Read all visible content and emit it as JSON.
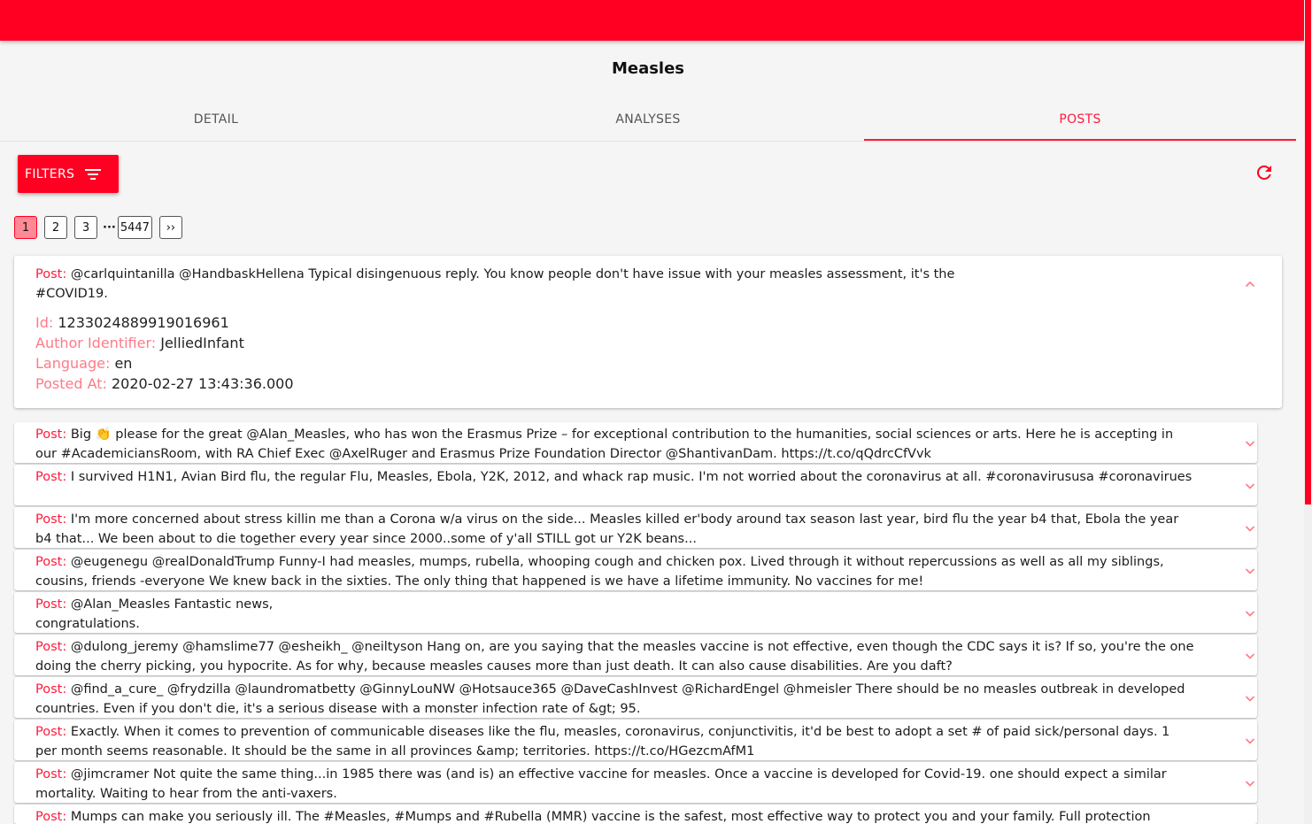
{
  "page": {
    "title": "Measles"
  },
  "tabs": [
    {
      "label": "DETAIL"
    },
    {
      "label": "ANALYSES"
    },
    {
      "label": "POSTS"
    }
  ],
  "toolbar": {
    "filters_label": "FILTERS"
  },
  "pagination": {
    "pages": [
      "1",
      "2",
      "3"
    ],
    "ellipsis": "···",
    "last": "5447",
    "next": "››"
  },
  "labels": {
    "post": "Post:",
    "id": "Id:",
    "author": "Author Identifier:",
    "language": "Language:",
    "posted_at": "Posted At:"
  },
  "expanded_post": {
    "text_line1": "@carlquintanilla @HandbaskHellena Typical disingenuous reply. You know people don't have issue with your measles assessment, it's the",
    "text_line2": "#COVID19.",
    "id": "1233024889919016961",
    "author": "JelliedInfant",
    "language": "en",
    "posted_at": "2020-02-27 13:43:36.000"
  },
  "posts": [
    {
      "text": "Big 👏 please for the great @Alan_Measles, who has won the Erasmus Prize – for exceptional contribution to the humanities, social sciences or arts. Here he is accepting in our #AcademiciansRoom, with RA Chief Exec @AxelRuger and Erasmus Prize Foundation Director @ShantivanDam. https://t.co/qQdrcCfVvk"
    },
    {
      "text": "I survived H1N1, Avian Bird flu, the regular Flu, Measles, Ebola, Y2K, 2012, and whack rap music. I'm not worried about the coronavirus at all. #coronavirususa #coronavirues"
    },
    {
      "text": "I'm more concerned about stress killin me than a Corona w/a virus on the side... Measles killed er'body around tax season last year, bird flu the year b4 that, Ebola the year b4 that... We been about to die together every year since 2000..some of y'all STILL got ur Y2K beans..."
    },
    {
      "text": "@eugenegu @realDonaldTrump Funny-I had measles, mumps, rubella, whooping cough and chicken pox. Lived through it without repercussions as well as all my siblings, cousins, friends -everyone We knew back in the sixties. The only thing that happened is we have a lifetime immunity. No vaccines for me!"
    },
    {
      "text": "@Alan_Measles Fantastic news,\ncongratulations."
    },
    {
      "text": "@dulong_jeremy @hamslime77 @esheikh_ @neiltyson Hang on, are you saying that the measles vaccine is not effective, even though the CDC says it is? If so, you're the one doing the cherry picking, you hypocrite. As for why, because measles causes more than just death. It can also cause disabilities. Are you daft?"
    },
    {
      "text": "@find_a_cure_ @frydzilla @laundromatbetty @GinnyLouNW @Hotsauce365 @DaveCashInvest @RichardEngel @hmeisler There should be no measles outbreak in developed countries. Even if you don't die, it's a serious disease with a monster infection rate of &gt; 95."
    },
    {
      "text": "Exactly. When it comes to prevention of communicable diseases like the flu, measles, coronavirus, conjunctivitis, it'd be best to adopt a set # of paid sick/personal days. 1 per month seems reasonable. It should be the same in all provinces &amp; territories. https://t.co/HGezcmAfM1"
    },
    {
      "text": "@jimcramer Not quite the same thing...in 1985 there was (and is) an effective vaccine for measles. Once a vaccine is developed for Covid-19. one should expect a similar mortality. Waiting to hear from the anti-vaxers."
    },
    {
      "text": "Mumps can make you seriously ill. The #Measles, #Mumps and #Rubella (MMR) vaccine is the safest, most effective way to protect you and your family. Full protection"
    }
  ]
}
